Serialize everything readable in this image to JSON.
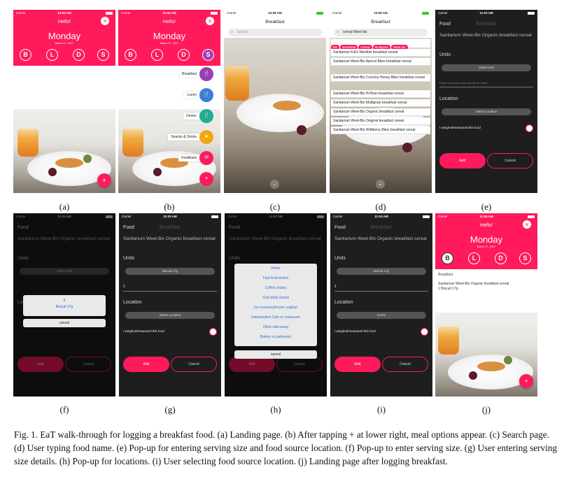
{
  "status": {
    "carrier": "Carrier",
    "time_a": "10:55 AM",
    "time_c": "10:59 AM",
    "time_f": "11:03 AM",
    "time_j": "11:06 AM"
  },
  "landing": {
    "hello": "Hello!",
    "day": "Monday",
    "date": "March 27, 2017",
    "close": "×",
    "meal_letters": [
      "B",
      "L",
      "D",
      "S"
    ],
    "fab": "+"
  },
  "meal_menu": {
    "items": [
      "Breakfast",
      "Lunch",
      "Dinner",
      "Snacks & Drinks",
      "Feedback"
    ],
    "colors": [
      "#9b3fb5",
      "#3b7fd8",
      "#1fae8f",
      "#f2a70f",
      "#ff1a5b"
    ],
    "close": "×"
  },
  "search": {
    "title": "Breakfast",
    "placeholder": "Search",
    "query": "cereal Weet bix",
    "chips": [
      "Bix",
      "Breakfast",
      "Cereal",
      "Multigrain",
      "Weet bix"
    ],
    "results": [
      "Sanitarium Kid's Weetbix breakfast cereal",
      "Sanitarium Weet-Bix Apricot Bites breakfast cereal",
      "Sanitarium Weet-Bix Crunchy Honey Bites breakfast cereal",
      "Sanitarium Weet-Bix Hi-Bran breakfast cereal",
      "Sanitarium Weet-Bix Multigrain breakfast cereal",
      "Sanitarium Weet-Bix Organic breakfast cereal",
      "Sanitarium Weet-Bix Original breakfast cereal",
      "Sanitarium Weet-Bix Wildberry Bites breakfast cereal"
    ]
  },
  "entry": {
    "food_label": "Food",
    "meal": "Breakfast",
    "food_name": "Sanitarium Weet-Bix Organic breakfast cereal",
    "units_label": "Units",
    "select_unit": "Select Unit",
    "hint": "Enter how many units you ate or drank",
    "location_label": "Location",
    "select_location": "Select Location",
    "weighed": "I weighed/measured this food",
    "add": "Add",
    "cancel": "Cancel",
    "unit_value": "Biscuit 17g",
    "qty": "1",
    "location_value": "Home"
  },
  "unit_popup": {
    "options": [
      "g",
      "Biscuit 17g"
    ],
    "cancel": "cancel"
  },
  "location_popup": {
    "options": [
      "Home",
      "Fast food chains",
      "Coffee chains",
      "Cold drink chains",
      "Ice creamery/frozen yoghurt",
      "Independent Cafe or restaurant",
      "Other take-away",
      "Bakery or patisserie"
    ],
    "cancel": "cancel"
  },
  "logged": {
    "section": "Breakfast",
    "food": "Sanitarium Weet-Bix Organic breakfast cereal",
    "qty": "1 Biscuit 17g"
  },
  "captions": [
    "(a)",
    "(b)",
    "(c)",
    "(d)",
    "(e)",
    "(f)",
    "(g)",
    "(h)",
    "(i)",
    "(j)"
  ],
  "figure_caption": "Fig. 1.  EaT walk-through for logging a breakfast food. (a) Landing page. (b) After tapping + at lower right, meal options appear. (c) Search page. (d) User typing food name. (e) Pop-up for entering serving size and food source location. (f) Pop-up to enter serving size. (g) User entering serving size details. (h) Pop-up for locations. (i) User selecting food source location. (j) Landing page after logging breakfast."
}
